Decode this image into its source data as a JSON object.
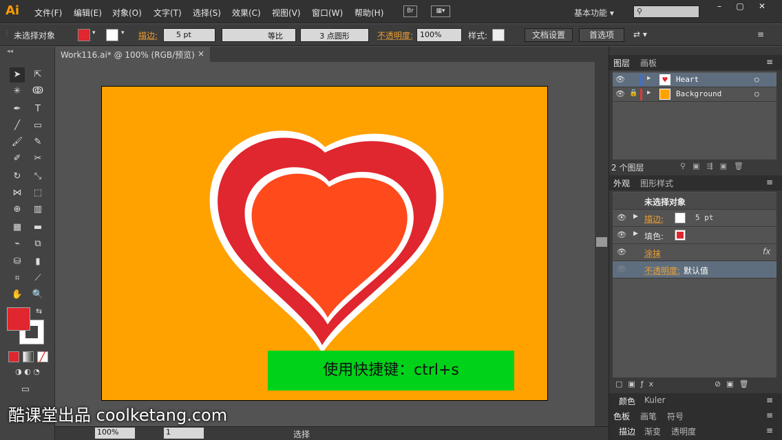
{
  "app": {
    "logo": "Ai"
  },
  "menu": [
    "文件(F)",
    "编辑(E)",
    "对象(O)",
    "文字(T)",
    "选择(S)",
    "效果(C)",
    "视图(V)",
    "窗口(W)",
    "帮助(H)"
  ],
  "bridge_label": "Br",
  "workspace": "基本功能",
  "control": {
    "selection": "未选择对象",
    "stroke_label": "描边:",
    "stroke_value": "5 pt",
    "stroke_style": "等比",
    "brush": "3 点圆形",
    "opacity_label": "不透明度:",
    "opacity_value": "100%",
    "style_label": "样式:",
    "doc_settings": "文档设置",
    "preferences": "首选项"
  },
  "document_tab": {
    "title": "Work116.ai* @ 100% (RGB/预览)",
    "close": "×"
  },
  "canvas": {
    "artboard_color": "#ffa200",
    "tip": "使用快捷键：ctrl+s",
    "watermark": "酷课堂出品 coolketang.com"
  },
  "status": {
    "zoom": "100%",
    "page": "1",
    "tool": "选择"
  },
  "layers_panel": {
    "tabs": [
      "图层",
      "画板"
    ],
    "layers": [
      {
        "name": "Heart",
        "color": "#3a6fe0"
      },
      {
        "name": "Background",
        "color": "#e03a3a"
      }
    ],
    "count": "2 个图层"
  },
  "appearance_panel": {
    "tabs": [
      "外观",
      "图形样式"
    ],
    "title": "未选择对象",
    "stroke_label": "描边:",
    "stroke_value": "5 pt",
    "fill_label": "填色:",
    "scribble": "涂抹",
    "opacity_label": "不透明度:",
    "opacity_value": "默认值",
    "fx": "fx"
  },
  "collapsed_panels": [
    [
      "颜色",
      "Kuler"
    ],
    [
      "色板",
      "画笔",
      "符号"
    ],
    [
      "描边",
      "渐变",
      "透明度"
    ]
  ],
  "colors": {
    "fill": "#e0262e",
    "stroke": "#ffffff",
    "heart_inner": "#ff4a1c"
  }
}
